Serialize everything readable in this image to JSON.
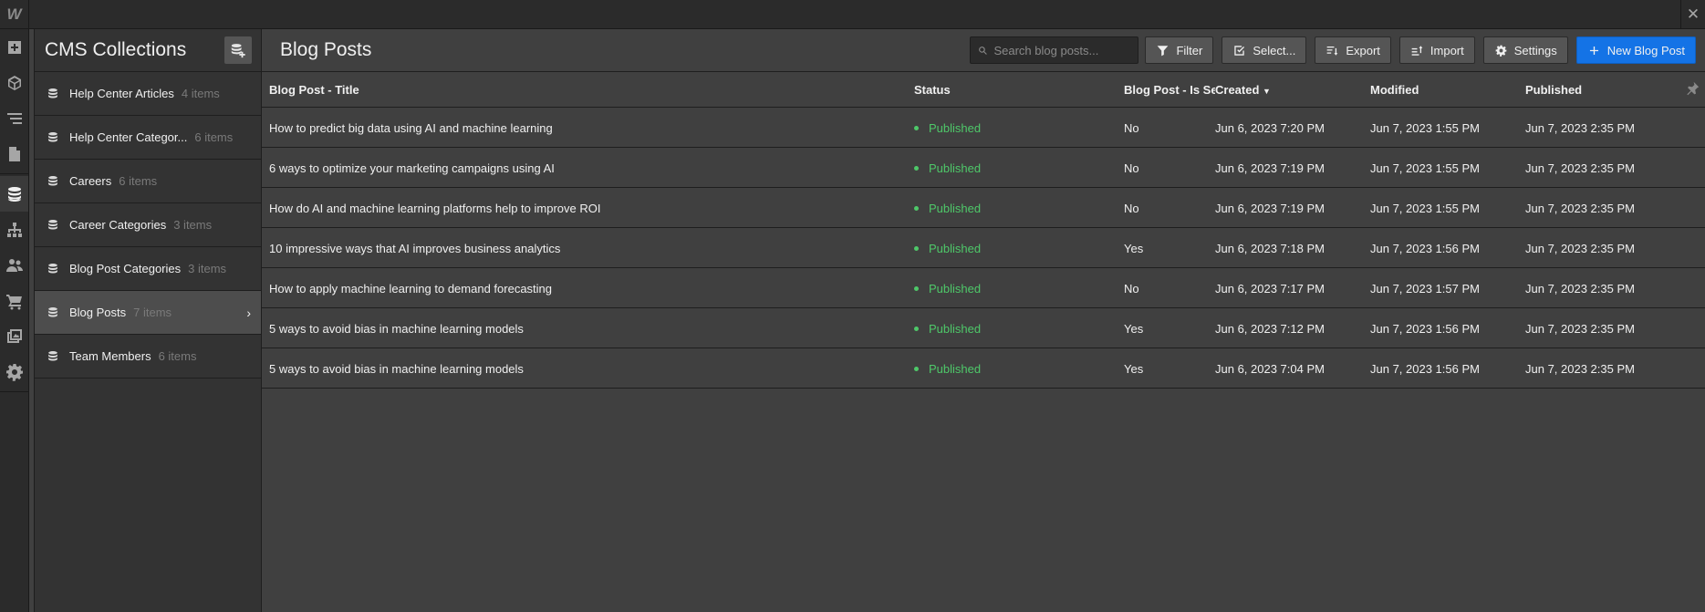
{
  "app": {
    "logo": "W",
    "close_icon": "close-icon"
  },
  "rail": [
    "add-icon",
    "cube-icon",
    "navigator-icon",
    "pages-icon",
    "cms-icon",
    "sitemap-icon",
    "users-icon",
    "ecommerce-icon",
    "assets-icon",
    "settings-icon"
  ],
  "collections": {
    "title": "CMS Collections",
    "items": [
      {
        "label": "Help Center Articles",
        "count": "4 items"
      },
      {
        "label": "Help Center Categor...",
        "count": "6 items"
      },
      {
        "label": "Careers",
        "count": "6 items"
      },
      {
        "label": "Career Categories",
        "count": "3 items"
      },
      {
        "label": "Blog Post Categories",
        "count": "3 items"
      },
      {
        "label": "Blog Posts",
        "count": "7 items"
      },
      {
        "label": "Team Members",
        "count": "6 items"
      }
    ]
  },
  "main": {
    "title": "Blog Posts",
    "search_placeholder": "Search blog posts...",
    "buttons": {
      "filter": "Filter",
      "select": "Select...",
      "export": "Export",
      "import": "Import",
      "settings": "Settings",
      "new": "New Blog Post"
    },
    "columns": {
      "title": "Blog Post - Title",
      "status": "Status",
      "is_se": "Blog Post - Is Se",
      "created": "Created",
      "modified": "Modified",
      "published": "Published"
    },
    "rows": [
      {
        "title": "How to predict big data using AI and machine learning",
        "status": "Published",
        "is_se": "No",
        "created": "Jun 6, 2023 7:20 PM",
        "modified": "Jun 7, 2023 1:55 PM",
        "published": "Jun 7, 2023 2:35 PM"
      },
      {
        "title": "6 ways to optimize your marketing campaigns using AI",
        "status": "Published",
        "is_se": "No",
        "created": "Jun 6, 2023 7:19 PM",
        "modified": "Jun 7, 2023 1:55 PM",
        "published": "Jun 7, 2023 2:35 PM"
      },
      {
        "title": "How do AI and machine learning platforms help to improve ROI",
        "status": "Published",
        "is_se": "No",
        "created": "Jun 6, 2023 7:19 PM",
        "modified": "Jun 7, 2023 1:55 PM",
        "published": "Jun 7, 2023 2:35 PM"
      },
      {
        "title": "10 impressive ways that AI improves business analytics",
        "status": "Published",
        "is_se": "Yes",
        "created": "Jun 6, 2023 7:18 PM",
        "modified": "Jun 7, 2023 1:56 PM",
        "published": "Jun 7, 2023 2:35 PM"
      },
      {
        "title": "How to apply machine learning to demand forecasting",
        "status": "Published",
        "is_se": "No",
        "created": "Jun 6, 2023 7:17 PM",
        "modified": "Jun 7, 2023 1:57 PM",
        "published": "Jun 7, 2023 2:35 PM"
      },
      {
        "title": "5 ways to avoid bias in machine learning models",
        "status": "Published",
        "is_se": "Yes",
        "created": "Jun 6, 2023 7:12 PM",
        "modified": "Jun 7, 2023 1:56 PM",
        "published": "Jun 7, 2023 2:35 PM"
      },
      {
        "title": "5 ways to avoid bias in machine learning models",
        "status": "Published",
        "is_se": "Yes",
        "created": "Jun 6, 2023 7:04 PM",
        "modified": "Jun 7, 2023 1:56 PM",
        "published": "Jun 7, 2023 2:35 PM"
      }
    ]
  },
  "colors": {
    "accent": "#1473e6",
    "published": "#4ec869"
  }
}
